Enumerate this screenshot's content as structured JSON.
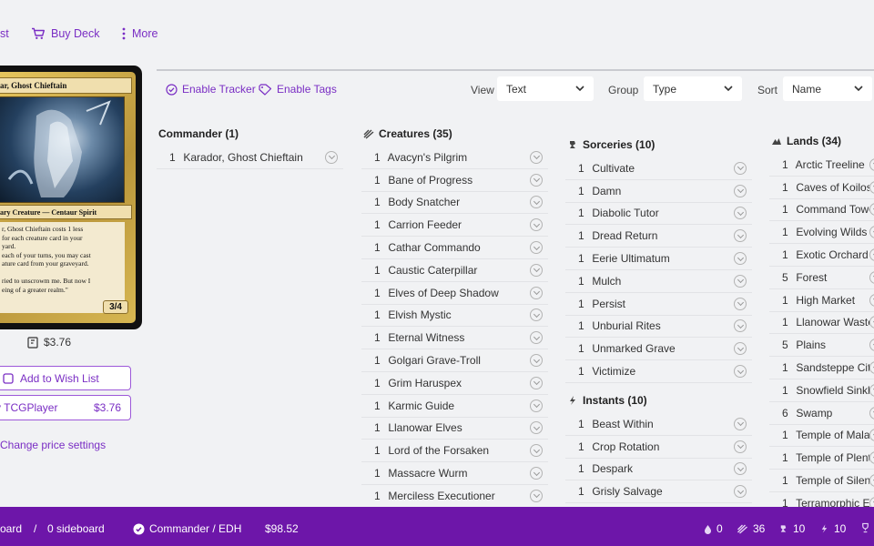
{
  "topbar": {
    "cut_label": "st",
    "buy_deck": "Buy Deck",
    "more": "More"
  },
  "card": {
    "title": "ar, Ghost Chieftain",
    "type_line": "ary Creature — Centaur Spirit",
    "rules_text": "r, Ghost Chieftain costs 1 less\nfor each creature card in your\nyard.\n each of your turns, you may cast\nature card from your graveyard.\n\nried to unscrowm me. But now I\neing of a greater realm.\"",
    "pt": "3/4",
    "price": "$3.76"
  },
  "sidebar": {
    "wish_list": "Add to Wish List",
    "tcg_label": "y TCGPlayer",
    "tcg_price": "$3.76",
    "change_price": "Change price settings"
  },
  "toolbar": {
    "enable_tracker": "Enable Tracker",
    "enable_tags": "Enable Tags",
    "view_label": "View",
    "view_value": "Text",
    "group_label": "Group",
    "group_value": "Type",
    "sort_label": "Sort",
    "sort_value": "Name"
  },
  "columns": {
    "commander": {
      "header": "Commander (1)",
      "items": [
        {
          "qty": "1",
          "name": "Karador, Ghost Chieftain"
        }
      ]
    },
    "creatures": {
      "header": "Creatures (35)",
      "icon": "creature-icon",
      "items": [
        {
          "qty": "1",
          "name": "Avacyn's Pilgrim"
        },
        {
          "qty": "1",
          "name": "Bane of Progress"
        },
        {
          "qty": "1",
          "name": "Body Snatcher"
        },
        {
          "qty": "1",
          "name": "Carrion Feeder"
        },
        {
          "qty": "1",
          "name": "Cathar Commando"
        },
        {
          "qty": "1",
          "name": "Caustic Caterpillar"
        },
        {
          "qty": "1",
          "name": "Elves of Deep Shadow"
        },
        {
          "qty": "1",
          "name": "Elvish Mystic"
        },
        {
          "qty": "1",
          "name": "Eternal Witness"
        },
        {
          "qty": "1",
          "name": "Golgari Grave-Troll"
        },
        {
          "qty": "1",
          "name": "Grim Haruspex"
        },
        {
          "qty": "1",
          "name": "Karmic Guide"
        },
        {
          "qty": "1",
          "name": "Llanowar Elves"
        },
        {
          "qty": "1",
          "name": "Lord of the Forsaken"
        },
        {
          "qty": "1",
          "name": "Massacre Wurm"
        },
        {
          "qty": "1",
          "name": "Merciless Executioner"
        }
      ]
    },
    "sorceries": {
      "header": "Sorceries (10)",
      "icon": "sorcery-icon",
      "items": [
        {
          "qty": "1",
          "name": "Cultivate"
        },
        {
          "qty": "1",
          "name": "Damn"
        },
        {
          "qty": "1",
          "name": "Diabolic Tutor"
        },
        {
          "qty": "1",
          "name": "Dread Return"
        },
        {
          "qty": "1",
          "name": "Eerie Ultimatum"
        },
        {
          "qty": "1",
          "name": "Mulch"
        },
        {
          "qty": "1",
          "name": "Persist"
        },
        {
          "qty": "1",
          "name": "Unburial Rites"
        },
        {
          "qty": "1",
          "name": "Unmarked Grave"
        },
        {
          "qty": "1",
          "name": "Victimize"
        }
      ]
    },
    "instants": {
      "header": "Instants (10)",
      "icon": "instant-icon",
      "items": [
        {
          "qty": "1",
          "name": "Beast Within"
        },
        {
          "qty": "1",
          "name": "Crop Rotation"
        },
        {
          "qty": "1",
          "name": "Despark"
        },
        {
          "qty": "1",
          "name": "Grisly Salvage"
        }
      ]
    },
    "lands": {
      "header": "Lands (34)",
      "icon": "land-icon",
      "items": [
        {
          "qty": "1",
          "name": "Arctic Treeline"
        },
        {
          "qty": "1",
          "name": "Caves of Koilos"
        },
        {
          "qty": "1",
          "name": "Command Tower"
        },
        {
          "qty": "1",
          "name": "Evolving Wilds"
        },
        {
          "qty": "1",
          "name": "Exotic Orchard"
        },
        {
          "qty": "5",
          "name": "Forest"
        },
        {
          "qty": "1",
          "name": "High Market"
        },
        {
          "qty": "1",
          "name": "Llanowar Wastes"
        },
        {
          "qty": "5",
          "name": "Plains"
        },
        {
          "qty": "1",
          "name": "Sandsteppe Citad"
        },
        {
          "qty": "1",
          "name": "Snowfield Sinkhol"
        },
        {
          "qty": "6",
          "name": "Swamp"
        },
        {
          "qty": "1",
          "name": "Temple of Malady"
        },
        {
          "qty": "1",
          "name": "Temple of Plenty"
        },
        {
          "qty": "1",
          "name": "Temple of Silence"
        },
        {
          "qty": "1",
          "name": "Terramorphic Expa"
        }
      ]
    }
  },
  "footer": {
    "mainboard": "oard",
    "separator": "/",
    "sideboard": "0 sideboard",
    "format": "Commander / EDH",
    "price": "$98.52",
    "count_1": "0",
    "count_2": "36",
    "count_3": "10",
    "count_4": "10"
  },
  "colors": {
    "accent": "#7a2ec4",
    "footer_bg": "#6d16a9",
    "page_bg": "#f1f2f4"
  }
}
